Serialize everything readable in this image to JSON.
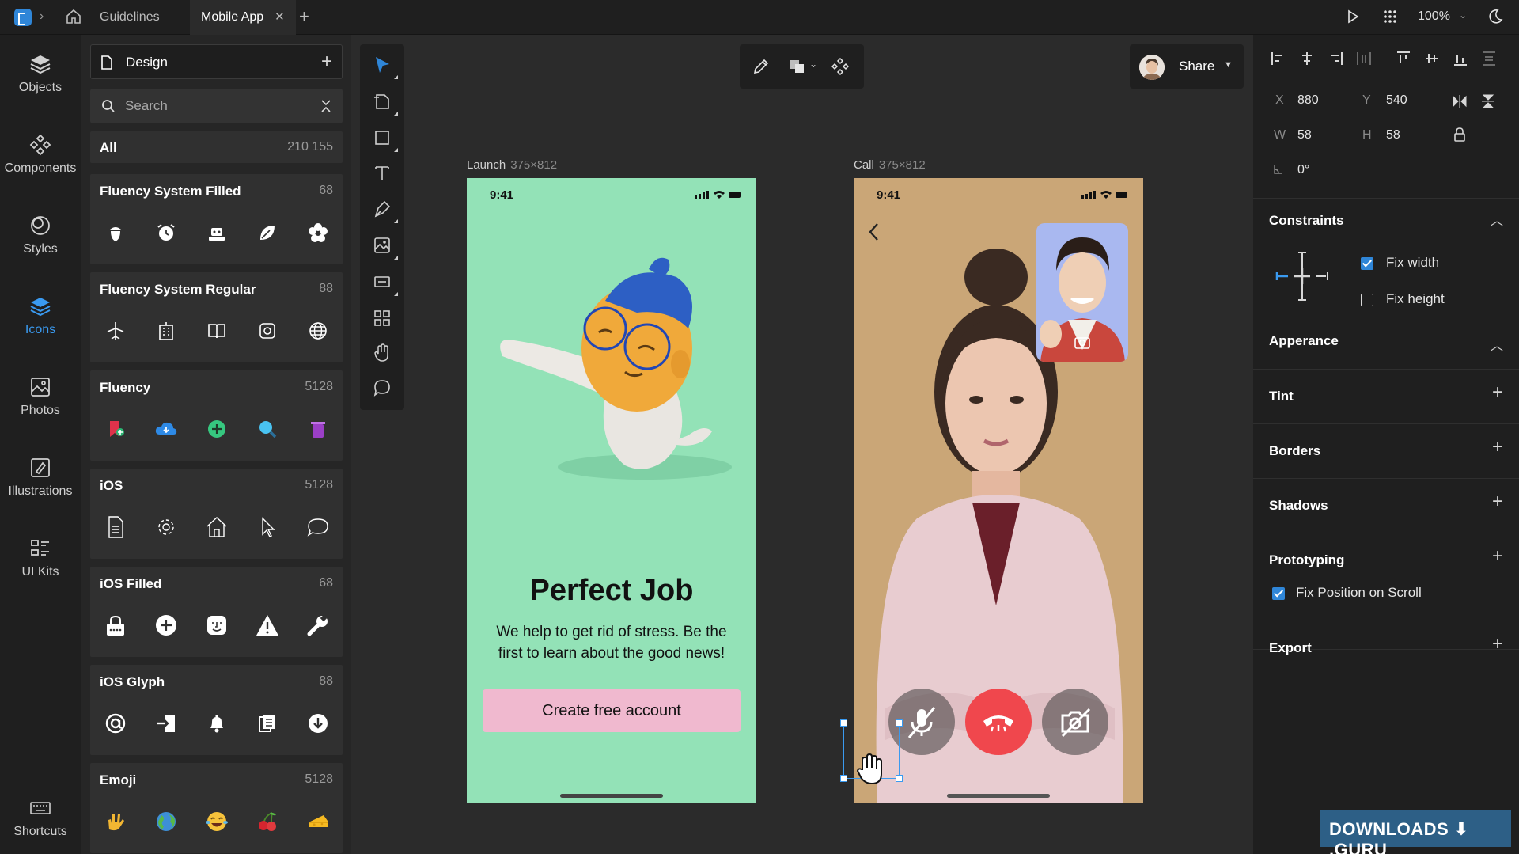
{
  "topbar": {
    "tabs": [
      {
        "label": "Guidelines"
      },
      {
        "label": "Mobile App",
        "active": true
      }
    ],
    "zoom": "100%"
  },
  "leftnav": [
    {
      "label": "Objects",
      "icon": "layers-icon"
    },
    {
      "label": "Components",
      "icon": "components-icon"
    },
    {
      "label": "Styles",
      "icon": "styles-icon"
    },
    {
      "label": "Icons",
      "icon": "icons-stack-icon",
      "active": true
    },
    {
      "label": "Photos",
      "icon": "photo-icon"
    },
    {
      "label": "Illustrations",
      "icon": "illustration-icon"
    },
    {
      "label": "UI Kits",
      "icon": "ui-kit-icon"
    },
    {
      "label": "Shortcuts",
      "icon": "keyboard-icon"
    }
  ],
  "panel": {
    "design_label": "Design",
    "search_placeholder": "Search",
    "all": {
      "label": "All",
      "count": "210 155"
    },
    "sets": [
      {
        "name": "Fluency System Filled",
        "count": "68",
        "icons": [
          "acorn-icon",
          "alarm-clock-icon",
          "robot-icon",
          "leaf-icon",
          "flower-icon"
        ]
      },
      {
        "name": "Fluency System Regular",
        "count": "88",
        "icons": [
          "airplane-icon",
          "building-icon",
          "book-open-icon",
          "contact-card-icon",
          "globe-icon"
        ]
      },
      {
        "name": "Fluency",
        "count": "5128",
        "icons": [
          "bookmark-add-icon",
          "cloud-download-icon",
          "add-circle-icon",
          "magnifier-icon",
          "trash-icon"
        ]
      },
      {
        "name": "iOS",
        "count": "5128",
        "icons": [
          "document-icon",
          "settings-gear-icon",
          "home-outline-icon",
          "cursor-icon",
          "speech-bubble-icon"
        ]
      },
      {
        "name": "iOS Filled",
        "count": "68",
        "icons": [
          "password-lock-icon",
          "plus-circle-icon",
          "face-id-icon",
          "warning-triangle-icon",
          "wrench-icon"
        ]
      },
      {
        "name": "iOS Glyph",
        "count": "88",
        "icons": [
          "at-sign-icon",
          "sign-in-icon",
          "bell-icon",
          "copy-icon",
          "download-circle-icon"
        ]
      },
      {
        "name": "Emoji",
        "count": "5128",
        "icons": [
          "love-you-hand-icon",
          "globe-earth-icon",
          "laughing-face-icon",
          "cherries-icon",
          "cheese-icon"
        ]
      }
    ]
  },
  "canvas": {
    "share_label": "Share",
    "frames": [
      {
        "name": "Launch",
        "size": "375×812",
        "time": "9:41",
        "headline": "Perfect Job",
        "body": "We help to get rid of stress. Be the first to learn about the good news!",
        "cta": "Create free account"
      },
      {
        "name": "Call",
        "size": "375×812",
        "time": "9:41"
      }
    ]
  },
  "props": {
    "x_label": "X",
    "x": "880",
    "y_label": "Y",
    "y": "540",
    "w_label": "W",
    "w": "58",
    "h_label": "H",
    "h": "58",
    "rotation": "0°",
    "constraints_title": "Constraints",
    "fix_width": "Fix width",
    "fix_height": "Fix height",
    "appearance_title": "Apperance",
    "tint_title": "Tint",
    "borders_title": "Borders",
    "shadows_title": "Shadows",
    "prototyping_title": "Prototyping",
    "fix_position": "Fix Position on Scroll",
    "export_title": "Export"
  },
  "watermark": "DOWNLOADS ⬇ .GURU",
  "colors": {
    "accent": "#3a9af0",
    "launch_bg": "#93e2b7",
    "call_bg": "#caa677",
    "cta_bg": "#f0b9cf",
    "end_call": "#f0474d"
  }
}
